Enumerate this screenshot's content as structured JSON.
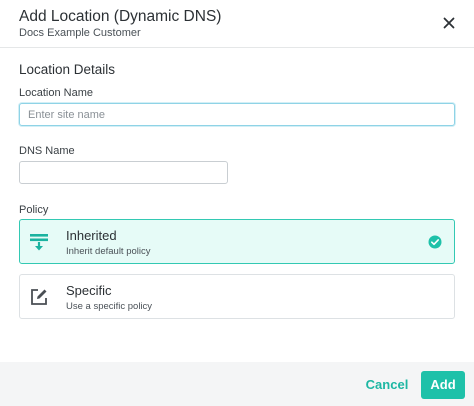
{
  "header": {
    "title": "Add Location (Dynamic DNS)",
    "subtitle": "Docs Example Customer"
  },
  "section": {
    "title": "Location Details"
  },
  "fields": {
    "location_name": {
      "label": "Location Name",
      "placeholder": "Enter site name",
      "value": ""
    },
    "dns_name": {
      "label": "DNS Name",
      "placeholder": "",
      "value": ""
    }
  },
  "policy": {
    "label": "Policy",
    "options": [
      {
        "title": "Inherited",
        "description": "Inherit default policy",
        "icon": "inherited-policy-icon",
        "selected": true
      },
      {
        "title": "Specific",
        "description": "Use a specific policy",
        "icon": "edit-icon",
        "selected": false
      }
    ]
  },
  "footer": {
    "cancel_label": "Cancel",
    "add_label": "Add"
  },
  "colors": {
    "accent": "#1ec1a9",
    "selected_card_bg": "#e6fbf7",
    "selected_card_border": "#33c9b3",
    "footer_bg": "#f4f5f6"
  }
}
